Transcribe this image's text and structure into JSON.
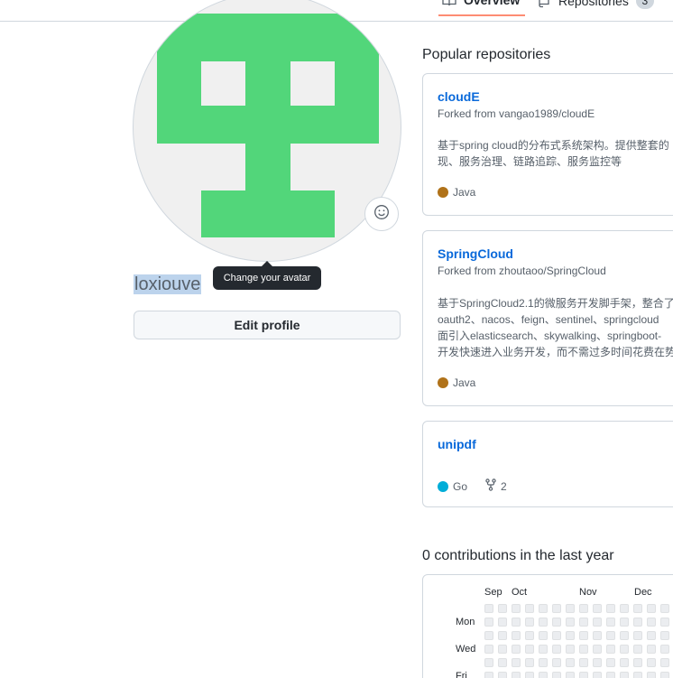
{
  "tabs": {
    "overview": "Overview",
    "repositories": "Repositories",
    "repositories_count": "3"
  },
  "profile": {
    "username": "loxiouve",
    "avatar_tooltip": "Change your avatar",
    "edit_profile": "Edit profile",
    "avatar_color": "#52d67a"
  },
  "popular": {
    "title": "Popular repositories",
    "repos": [
      {
        "name": "cloudE",
        "forked_from": "Forked from vangao1989/cloudE",
        "desc_lines": [
          "基于spring cloud的分布式系统架构。提供整套的",
          "现、服务治理、链路追踪、服务监控等"
        ],
        "language": "Java",
        "language_color": "#b07219"
      },
      {
        "name": "SpringCloud",
        "forked_from": "Forked from zhoutaoo/SpringCloud",
        "desc_lines": [
          "基于SpringCloud2.1的微服务开发脚手架，整合了",
          "oauth2、nacos、feign、sentinel、springcloud",
          "面引入elasticsearch、skywalking、springboot-",
          "开发快速进入业务开发，而不需过多时间花费在势"
        ],
        "language": "Java",
        "language_color": "#b07219"
      },
      {
        "name": "unipdf",
        "language": "Go",
        "language_color": "#00add8",
        "forks": "2"
      }
    ]
  },
  "contributions": {
    "title": "0 contributions in the last year",
    "months": [
      "Sep",
      "Oct",
      "Nov",
      "Dec"
    ],
    "days": [
      "Mon",
      "Wed",
      "Fri"
    ]
  }
}
